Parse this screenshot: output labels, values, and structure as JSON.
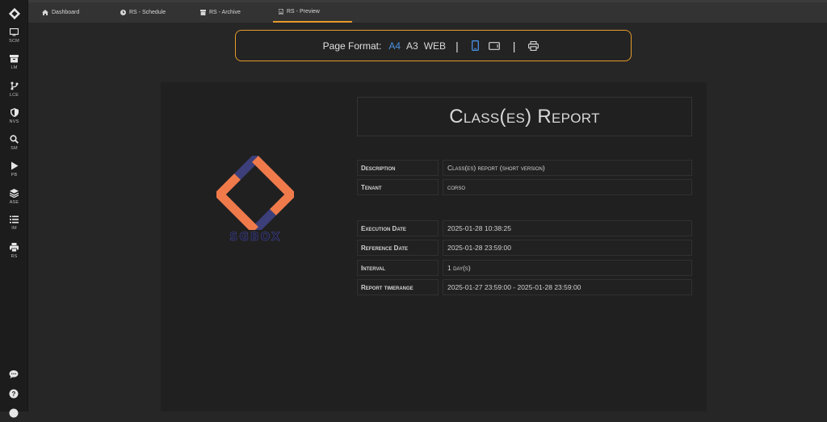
{
  "sidebar": {
    "items": [
      {
        "label": "SCM",
        "icon": "monitor-icon"
      },
      {
        "label": "LM",
        "icon": "archive-box-icon"
      },
      {
        "label": "LCE",
        "icon": "git-branch-icon"
      },
      {
        "label": "NVS",
        "icon": "shield-icon"
      },
      {
        "label": "SM",
        "icon": "search-icon"
      },
      {
        "label": "PB",
        "icon": "play-icon"
      },
      {
        "label": "ASE",
        "icon": "layers-icon"
      },
      {
        "label": "IM",
        "icon": "list-icon"
      },
      {
        "label": "RS",
        "icon": "printer-icon"
      }
    ],
    "bottom_icons": [
      "chat-icon",
      "help-icon"
    ]
  },
  "tabs": [
    {
      "label": "Dashboard",
      "icon": "home-icon"
    },
    {
      "label": "RS - Schedule",
      "icon": "clock-icon"
    },
    {
      "label": "RS - Archive",
      "icon": "archive-icon"
    },
    {
      "label": "RS - Preview",
      "icon": "document-icon",
      "active": true
    }
  ],
  "format_bar": {
    "label": "Page Format:",
    "options": [
      "A4",
      "A3",
      "WEB"
    ],
    "selected": "A4",
    "separator": "|",
    "icons": [
      "portrait-icon",
      "landscape-icon",
      "printer-icon"
    ],
    "orientation": "portrait"
  },
  "report": {
    "title": "Class(es) Report",
    "brand_text": "SGBOX",
    "details": [
      {
        "key": "Description",
        "value": "Class(es) report (short version)"
      },
      {
        "key": "Tenant",
        "value": "corso"
      }
    ],
    "dates": [
      {
        "key": "Execution Date",
        "value": "2025-01-28 10:38:25"
      },
      {
        "key": "Reference Date",
        "value": "2025-01-28 23:59:00"
      },
      {
        "key": "Interval",
        "value": "1 day(s)"
      },
      {
        "key": "Report timerange",
        "value": "2025-01-27 23:59:00 - 2025-01-28 23:59:00"
      }
    ]
  },
  "colors": {
    "accent": "#e59a2b",
    "selected_option": "#4a90e2",
    "brand_orange": "#f07a4a",
    "brand_navy": "#3c3f7a"
  }
}
